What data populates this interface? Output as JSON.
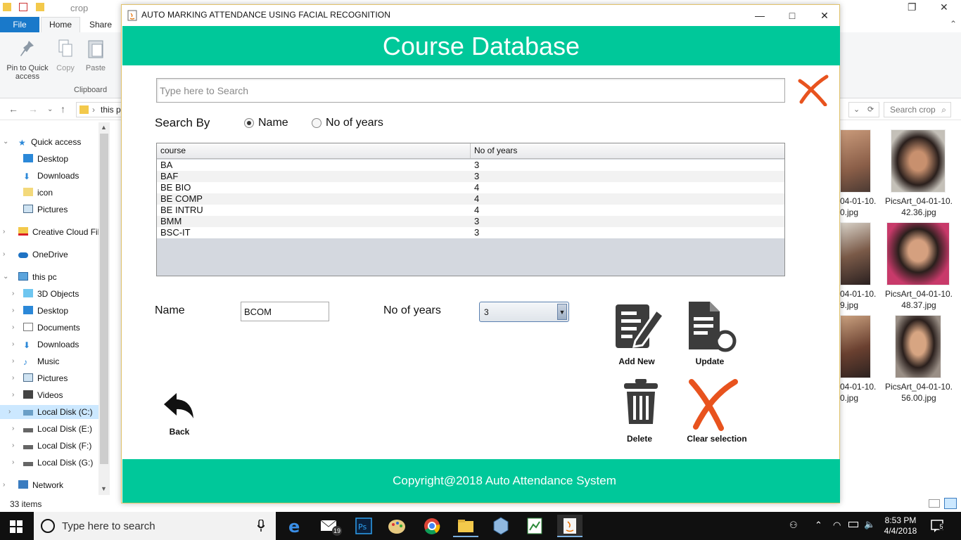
{
  "explorer": {
    "window_title": "crop",
    "tabs": [
      "File",
      "Home",
      "Share"
    ],
    "ribbon": {
      "pin_label": "Pin to Quick access",
      "copy_label": "Copy",
      "paste_label": "Paste",
      "group_label": "Clipboard"
    },
    "address_text": "this p",
    "search_placeholder": "Search crop",
    "nav": {
      "quick_access": "Quick access",
      "desktop": "Desktop",
      "downloads": "Downloads",
      "icon": "icon",
      "pictures": "Pictures",
      "creative_cloud": "Creative Cloud Fil",
      "onedrive": "OneDrive",
      "this_pc": "this pc",
      "objects_3d": "3D Objects",
      "desktop2": "Desktop",
      "documents": "Documents",
      "downloads2": "Downloads",
      "music": "Music",
      "pictures2": "Pictures",
      "videos": "Videos",
      "disk_c": "Local Disk (C:)",
      "disk_e": "Local Disk (E:)",
      "disk_f": "Local Disk (F:)",
      "disk_g": "Local Disk (G:)",
      "network": "Network"
    },
    "item_count": "33 items",
    "thumbs": [
      {
        "line1": "04-01-10.",
        "line2": "0.jpg"
      },
      {
        "line1": "PicsArt_04-01-10.",
        "line2": "42.36.jpg"
      },
      {
        "line1": "04-01-10.",
        "line2": "9.jpg"
      },
      {
        "line1": "PicsArt_04-01-10.",
        "line2": "48.37.jpg"
      },
      {
        "line1": "04-01-10.",
        "line2": "0.jpg"
      },
      {
        "line1": "PicsArt_04-01-10.",
        "line2": "56.00.jpg"
      }
    ]
  },
  "app": {
    "window_title": "AUTO MARKING ATTENDANCE USING FACIAL RECOGNITION",
    "header_title": "Course Database",
    "search": {
      "placeholder": "Type here to Search",
      "value": ""
    },
    "search_by_label": "Search By",
    "radio_name": "Name",
    "radio_years": "No of years",
    "selected_search_by": "Name",
    "table": {
      "columns": [
        "course",
        "No of years"
      ],
      "rows": [
        {
          "course": "BA",
          "years": "3"
        },
        {
          "course": "BAF",
          "years": "3"
        },
        {
          "course": "BE BIO",
          "years": "4"
        },
        {
          "course": "BE COMP",
          "years": "4"
        },
        {
          "course": "BE INTRU",
          "years": "4"
        },
        {
          "course": "BMM",
          "years": "3"
        },
        {
          "course": "BSC-IT",
          "years": "3"
        }
      ]
    },
    "form": {
      "name_label": "Name",
      "name_value": "BCOM",
      "years_label": "No of years",
      "years_value": "3"
    },
    "actions": {
      "add_new": "Add New",
      "update": "Update",
      "delete": "Delete",
      "clear_selection": "Clear selection",
      "back": "Back"
    },
    "footer": "Copyright@2018 Auto Attendance System"
  },
  "taskbar": {
    "search_placeholder": "Type here to search",
    "mail_badge": "19",
    "time": "8:53 PM",
    "date": "4/4/2018",
    "notification_count": "5"
  },
  "colors": {
    "accent_green": "#00c89a",
    "clear_x_orange": "#e8531e",
    "explorer_file_tab": "#1979ca"
  }
}
